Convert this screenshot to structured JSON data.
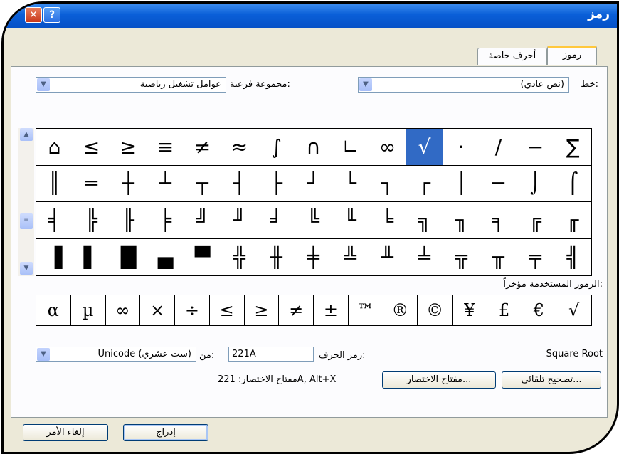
{
  "window": {
    "title": "رمز",
    "help_label": "?"
  },
  "tabs": [
    {
      "label": "رموز",
      "active": true
    },
    {
      "label": "أحرف خاصة",
      "active": false
    }
  ],
  "font": {
    "label": "خط:",
    "value": "(نص عادي)"
  },
  "subset": {
    "label": "مجموعة فرعية:",
    "value": "عوامل تشغيل رياضية"
  },
  "symbols": [
    [
      "∑",
      "−",
      "∕",
      "·",
      "√",
      "∞",
      "∟",
      "∩",
      "∫",
      "≈",
      "≠",
      "≡",
      "≥",
      "≤",
      "⌂",
      "⌐"
    ],
    [
      "⌠",
      "⌡",
      "─",
      "│",
      "┌",
      "┐",
      "└",
      "┘",
      "├",
      "┤",
      "┬",
      "┴",
      "┼",
      "═",
      "║",
      "╒"
    ],
    [
      "╓",
      "╔",
      "╕",
      "╖",
      "╗",
      "╘",
      "╙",
      "╚",
      "╛",
      "╜",
      "╝",
      "╞",
      "╟",
      "╠",
      "╡",
      "╢"
    ],
    [
      "╣",
      "╤",
      "╥",
      "╦",
      "╧",
      "╨",
      "╩",
      "╪",
      "╫",
      "╬",
      "▀",
      "▄",
      "█",
      "▌",
      "▐",
      "░"
    ]
  ],
  "selected_symbol": "√",
  "recent": {
    "label": "الرموز المستخدمة مؤخراً:",
    "items": [
      "√",
      "€",
      "£",
      "¥",
      "©",
      "®",
      "™",
      "±",
      "≠",
      "≥",
      "≤",
      "÷",
      "×",
      "∞",
      "µ",
      "α"
    ]
  },
  "char_name": "Square Root",
  "char_code": {
    "label": "رمز الحرف:",
    "value": "221A"
  },
  "from": {
    "label": "من:",
    "value": "Unicode (ست عشري)"
  },
  "buttons": {
    "autocorrect": "تصحيح تلقائي...",
    "shortcut_key": "مفتاح الاختصار...",
    "insert": "إدراج",
    "cancel": "إلغاء الأمر"
  },
  "shortcut_text": "مفتاح الاختصار: 221A, Alt+X"
}
